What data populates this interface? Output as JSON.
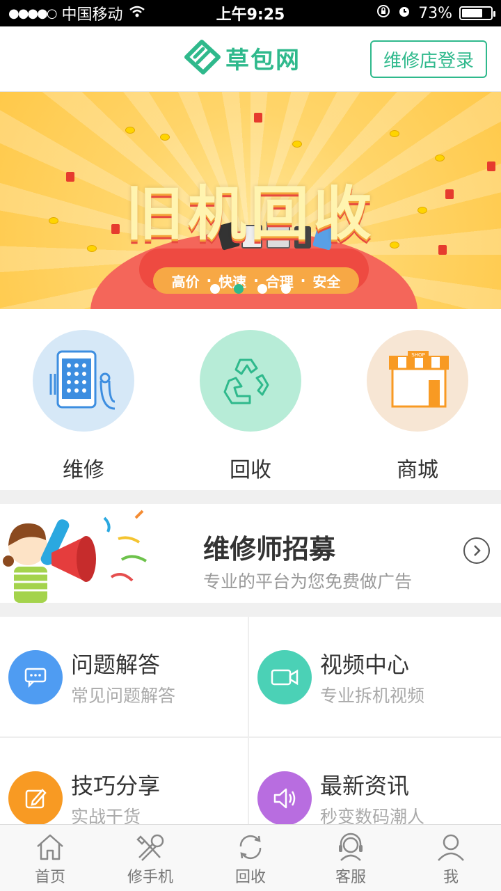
{
  "status_bar": {
    "carrier": "中国移动",
    "time": "上午9:25",
    "battery_percent": "73%",
    "battery_level": 0.73
  },
  "header": {
    "logo_text": "草包网",
    "login_button": "维修店登录"
  },
  "banner": {
    "title": "旧机回收",
    "features": [
      "高价",
      "快速",
      "合理",
      "安全"
    ],
    "separator": "·",
    "slide_count": 4,
    "active_slide": 2
  },
  "services": [
    {
      "label": "维修",
      "icon": "phone-repair-icon"
    },
    {
      "label": "回收",
      "icon": "recycle-icon"
    },
    {
      "label": "商城",
      "icon": "shop-icon"
    }
  ],
  "recruit": {
    "title": "维修师招募",
    "subtitle": "专业的平台为您免费做广告"
  },
  "grid": [
    {
      "title": "问题解答",
      "subtitle": "常见问题解答",
      "icon": "chat-icon",
      "color": "#4f9cf2"
    },
    {
      "title": "视频中心",
      "subtitle": "专业拆机视频",
      "icon": "video-icon",
      "color": "#4bd1b6"
    },
    {
      "title": "技巧分享",
      "subtitle": "实战干货",
      "icon": "edit-icon",
      "color": "#f89a23"
    },
    {
      "title": "最新资讯",
      "subtitle": "秒变数码潮人",
      "icon": "speaker-icon",
      "color": "#b86de0"
    }
  ],
  "tabbar": [
    {
      "label": "首页",
      "icon": "home-icon"
    },
    {
      "label": "修手机",
      "icon": "tools-icon"
    },
    {
      "label": "回收",
      "icon": "refresh-icon"
    },
    {
      "label": "客服",
      "icon": "headset-icon"
    },
    {
      "label": "我",
      "icon": "user-icon"
    }
  ],
  "colors": {
    "brand": "#2fb98c",
    "status_bar_bg": "#000000"
  }
}
